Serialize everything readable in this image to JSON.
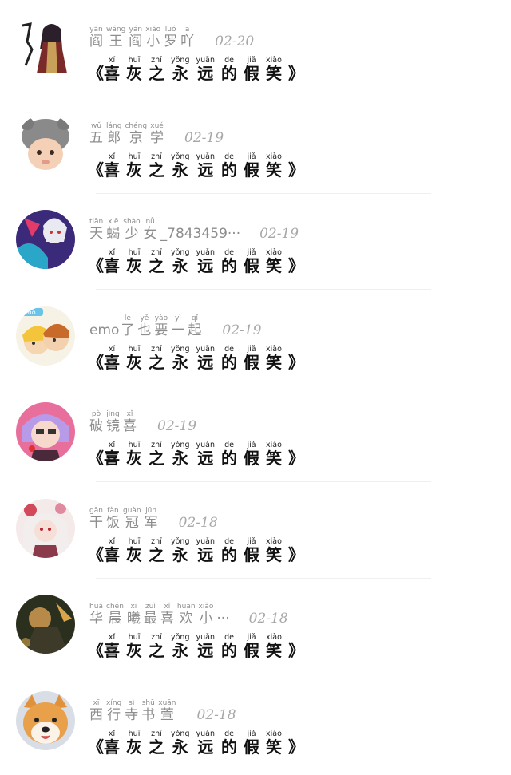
{
  "comments": [
    {
      "name_parts": [
        {
          "py": "yán",
          "hz": "阎"
        },
        {
          "py": "wáng",
          "hz": "王"
        },
        {
          "py": "yán",
          "hz": "阎"
        },
        {
          "py": "xiǎo",
          "hz": "小"
        },
        {
          "py": "luó",
          "hz": "罗"
        },
        {
          "py": "ā",
          "hz": "吖"
        }
      ],
      "date": "02-20",
      "avatar": "anime-girl-red-robe-avatar"
    },
    {
      "name_parts": [
        {
          "py": "wǔ",
          "hz": "五"
        },
        {
          "py": "láng",
          "hz": "郎"
        },
        {
          "py": "chéng",
          "hz": "京"
        },
        {
          "py": "xué",
          "hz": "学"
        }
      ],
      "date": "02-19",
      "avatar": "baby-grey-hat-avatar"
    },
    {
      "name_parts": [
        {
          "py": "tiān",
          "hz": "天"
        },
        {
          "py": "xiē",
          "hz": "蝎"
        },
        {
          "py": "shào",
          "hz": "少"
        },
        {
          "py": "nǚ",
          "hz": "女"
        },
        {
          "py": "",
          "hz": "_7843459···"
        }
      ],
      "date": "02-19",
      "avatar": "anime-white-hair-purple-avatar"
    },
    {
      "name_parts": [
        {
          "py": "",
          "hz": "emo"
        },
        {
          "py": "le",
          "hz": "了"
        },
        {
          "py": "yě",
          "hz": "也"
        },
        {
          "py": "yào",
          "hz": "要"
        },
        {
          "py": "yì",
          "hz": "一"
        },
        {
          "py": "qǐ",
          "hz": "起"
        }
      ],
      "date": "02-19",
      "avatar": "cartoon-couple-avatar"
    },
    {
      "name_parts": [
        {
          "py": "pò",
          "hz": "破"
        },
        {
          "py": "jìng",
          "hz": "镜"
        },
        {
          "py": "xǐ",
          "hz": "喜"
        }
      ],
      "date": "02-19",
      "avatar": "anime-purple-hair-avatar"
    },
    {
      "name_parts": [
        {
          "py": "gān",
          "hz": "干"
        },
        {
          "py": "fàn",
          "hz": "饭"
        },
        {
          "py": "guàn",
          "hz": "冠"
        },
        {
          "py": "jūn",
          "hz": "军"
        }
      ],
      "date": "02-18",
      "avatar": "anime-white-hair-flowers-avatar"
    },
    {
      "name_parts": [
        {
          "py": "huá",
          "hz": "华"
        },
        {
          "py": "chén",
          "hz": "晨"
        },
        {
          "py": "xī",
          "hz": "曦"
        },
        {
          "py": "zuì",
          "hz": "最"
        },
        {
          "py": "xǐ",
          "hz": "喜"
        },
        {
          "py": "huān",
          "hz": "欢"
        },
        {
          "py": "xiǎo",
          "hz": "小"
        },
        {
          "py": "",
          "hz": "···"
        }
      ],
      "date": "02-18",
      "avatar": "dark-warrior-avatar"
    },
    {
      "name_parts": [
        {
          "py": "xī",
          "hz": "西"
        },
        {
          "py": "xíng",
          "hz": "行"
        },
        {
          "py": "sì",
          "hz": "寺"
        },
        {
          "py": "shū",
          "hz": "书"
        },
        {
          "py": "xuān",
          "hz": "萱"
        }
      ],
      "date": "02-18",
      "avatar": "shiba-dog-avatar"
    }
  ],
  "comment_text": {
    "open": "《",
    "close": "》",
    "chars": [
      {
        "py": "xǐ",
        "hz": "喜"
      },
      {
        "py": "huī",
        "hz": "灰"
      },
      {
        "py": "zhī",
        "hz": "之"
      },
      {
        "py": "yǒng",
        "hz": "永"
      },
      {
        "py": "yuǎn",
        "hz": "远"
      },
      {
        "py": "de",
        "hz": "的"
      },
      {
        "py": "jiǎ",
        "hz": "假"
      },
      {
        "py": "xiào",
        "hz": "笑"
      }
    ]
  }
}
